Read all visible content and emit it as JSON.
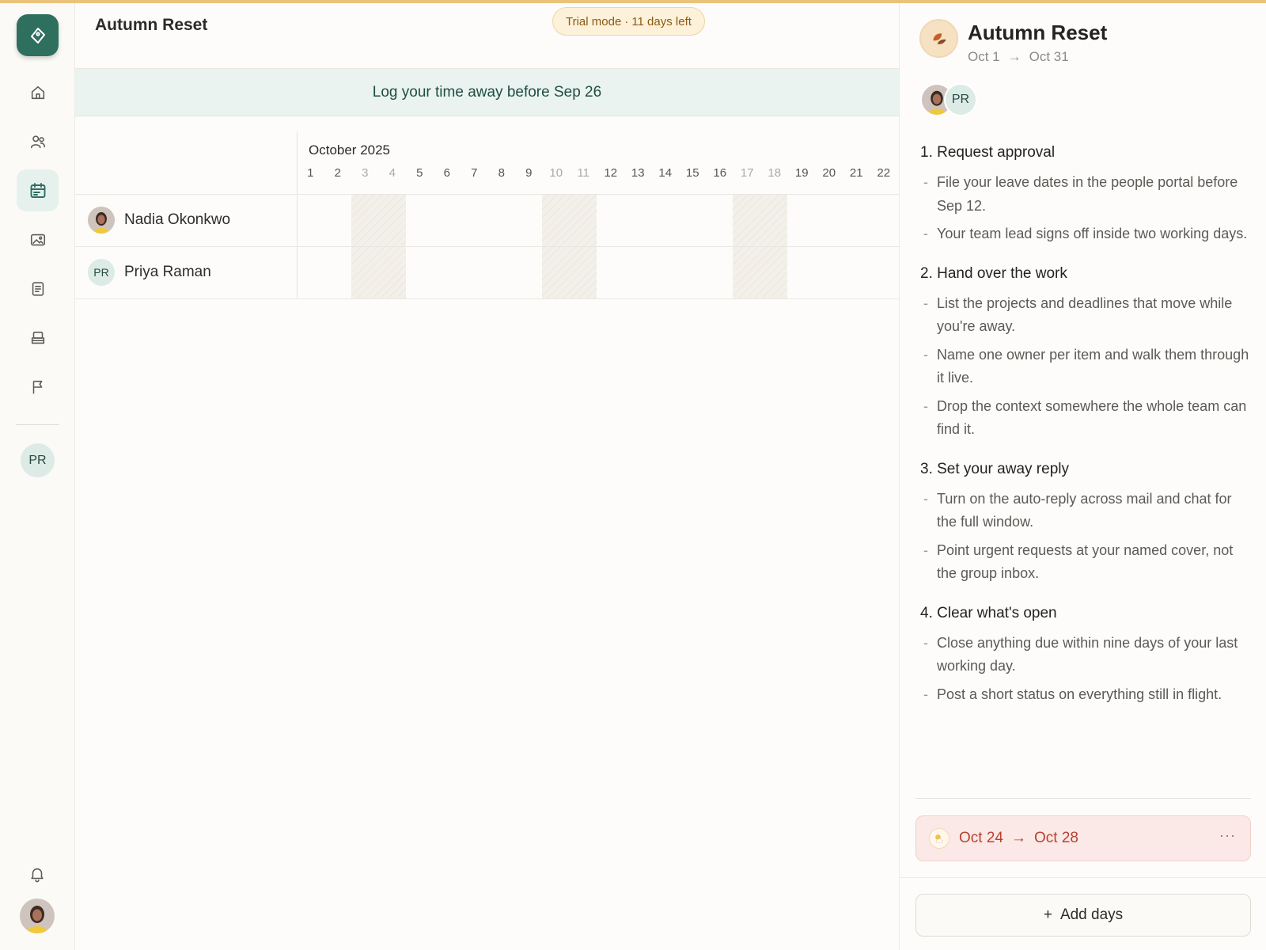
{
  "app": {
    "title": "Autumn Reset",
    "trial": {
      "label": "Trial mode",
      "separator": "·",
      "days_left": "11 days left"
    },
    "banner": "Log your time away before Sep 26"
  },
  "sidebar": {
    "user_initials": "PR",
    "items": [
      {
        "name": "home-icon"
      },
      {
        "name": "people-icon"
      },
      {
        "name": "calendar-icon",
        "active": true
      },
      {
        "name": "image-icon"
      },
      {
        "name": "document-icon"
      },
      {
        "name": "tray-icon"
      },
      {
        "name": "flag-icon"
      }
    ]
  },
  "calendar": {
    "month": "October 2025",
    "days": [
      "1",
      "2",
      "3",
      "4",
      "5",
      "6",
      "7",
      "8",
      "9",
      "10",
      "11",
      "12",
      "13",
      "14",
      "15",
      "16",
      "17",
      "18",
      "19",
      "20",
      "21",
      "22"
    ],
    "weekend_days": [
      "3",
      "4",
      "10",
      "11",
      "17",
      "18"
    ],
    "people": [
      {
        "name": "Nadia Okonkwo",
        "avatar": "photo"
      },
      {
        "name": "Priya Raman",
        "initials": "PR"
      }
    ]
  },
  "panel": {
    "title": "Autumn Reset",
    "start": "Oct 1",
    "end": "Oct 31",
    "arrow": "→",
    "avatar_initials": "PR",
    "steps": [
      {
        "title": "1. Request approval",
        "items": [
          "File your leave dates in the people portal before Sep 12.",
          "Your team lead signs off inside two working days."
        ]
      },
      {
        "title": "2. Hand over the work",
        "items": [
          "List the projects and deadlines that move while you're away.",
          "Name one owner per item and walk them through it live.",
          "Drop the context somewhere the whole team can find it."
        ]
      },
      {
        "title": "3. Set your away reply",
        "items": [
          "Turn on the auto-reply across mail and chat for the full window.",
          "Point urgent requests at your named cover, not the group inbox."
        ]
      },
      {
        "title": "4. Clear what's open",
        "items": [
          "Close anything due within nine days of your last working day.",
          "Post a short status on everything still in flight."
        ]
      }
    ],
    "leave": {
      "start": "Oct 24",
      "end": "Oct 28",
      "arrow": "→",
      "more": "···"
    },
    "add_label": "Add days",
    "add_icon": "+"
  },
  "colors": {
    "accent": "#2f6f5e",
    "banner_bg": "#eaf3f0",
    "trial_bg": "#fdf1da",
    "leave_bg": "#fbe9e7",
    "leave_text": "#b8412f"
  }
}
